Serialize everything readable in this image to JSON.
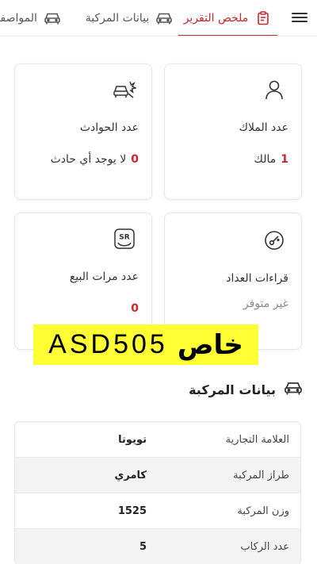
{
  "tabs": [
    {
      "label": "ملخص التقرير",
      "icon": "clipboard-icon",
      "active": true
    },
    {
      "label": "بيانات المركبة",
      "icon": "car-icon",
      "active": false
    },
    {
      "label": "المواصفات",
      "icon": "car-icon",
      "active": false
    }
  ],
  "cards": {
    "owners": {
      "label": "عدد الملاك",
      "num": "1",
      "text": "مالك",
      "icon": "user-icon"
    },
    "accidents": {
      "label": "عدد الحوادث",
      "num": "0",
      "text": "لا يوجد أي حادث",
      "icon": "car-crash-icon"
    },
    "odometer": {
      "label": "قراءات العداد",
      "text": "غير متوفر",
      "icon": "gauge-icon"
    },
    "sales": {
      "label": "عدد مرات البيع",
      "num": "0",
      "icon": "sr-badge-icon",
      "badge": "SR"
    }
  },
  "stamp": {
    "latin": "ASD505",
    "arabic": "خاص"
  },
  "section": {
    "title": "بيانات المركبة",
    "icon": "car-icon"
  },
  "vehicle_table": [
    {
      "key": "العلامة التجارية",
      "value": "تويوتا"
    },
    {
      "key": "طراز المركبة",
      "value": "كامري"
    },
    {
      "key": "وزن المركبة",
      "value": "1525"
    },
    {
      "key": "عدد الركاب",
      "value": "5"
    }
  ],
  "colors": {
    "accent": "#c8272e",
    "stamp_bg": "#ffff33"
  }
}
